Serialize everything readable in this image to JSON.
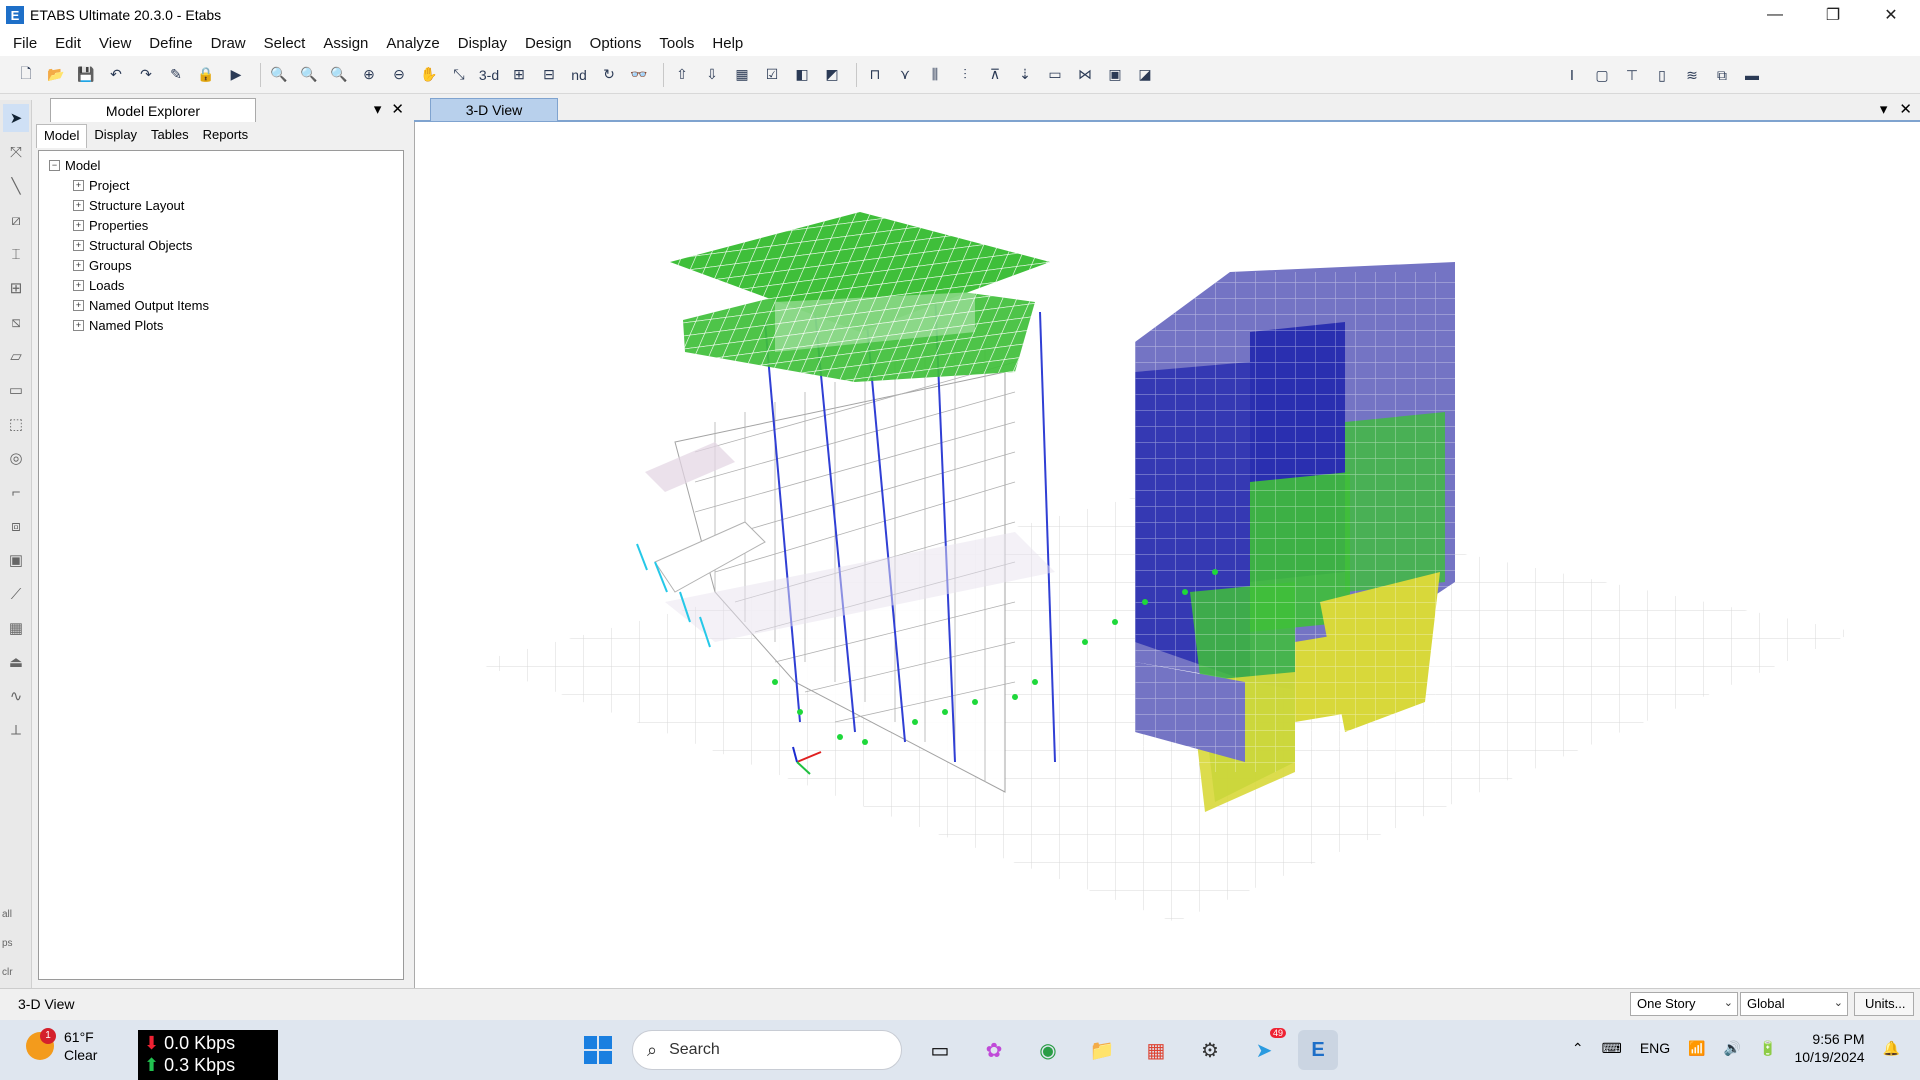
{
  "window": {
    "title": "ETABS Ultimate 20.3.0 - Etabs",
    "logo": "E",
    "minimize_icon": "—",
    "restore_icon": "❐",
    "close_icon": "✕"
  },
  "menu": [
    "File",
    "Edit",
    "View",
    "Define",
    "Draw",
    "Select",
    "Assign",
    "Analyze",
    "Display",
    "Design",
    "Options",
    "Tools",
    "Help"
  ],
  "toolbar": {
    "view3d_label": "3-d",
    "nd_label": "nd"
  },
  "explorer": {
    "title": "Model Explorer",
    "pin_icon": "▾",
    "close_icon": "✕",
    "tabs": [
      "Model",
      "Display",
      "Tables",
      "Reports"
    ],
    "active_tab": "Model",
    "root": "Model",
    "items": [
      "Project",
      "Structure Layout",
      "Properties",
      "Structural Objects",
      "Groups",
      "Loads",
      "Named Output Items",
      "Named Plots"
    ]
  },
  "view": {
    "tab_label": "3-D View",
    "dropdown_icon": "▾",
    "close_icon": "✕"
  },
  "left_tools": {
    "bottom_labels": [
      "all",
      "ps",
      "clr"
    ]
  },
  "statusbar": {
    "text": "3-D View",
    "story_select": "One Story",
    "coord_select": "Global",
    "units_button": "Units..."
  },
  "taskbar": {
    "weather_temp": "61°F",
    "weather_cond": "Clear",
    "weather_badge": "1",
    "net_down": "0.0 Kbps",
    "net_up": "0.3 Kbps",
    "search_placeholder": "Search",
    "telegram_badge": "49",
    "language": "ENG",
    "time": "9:56 PM",
    "date": "10/19/2024"
  },
  "colors": {
    "slab_green": "#3fbf3a",
    "wall_blue": "#2a2fb8",
    "wall_yellow": "#d8d83a",
    "wall_violet": "#7070c8",
    "accent": "#1e6fc8"
  }
}
